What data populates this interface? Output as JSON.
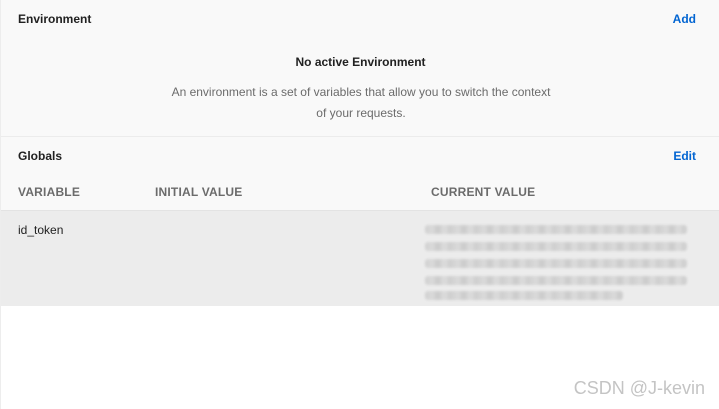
{
  "environment": {
    "title": "Environment",
    "action_label": "Add",
    "empty_title": "No active Environment",
    "empty_description": "An environment is a set of variables that allow you to switch the context of your requests."
  },
  "globals": {
    "title": "Globals",
    "action_label": "Edit",
    "columns": {
      "variable": "VARIABLE",
      "initial_value": "INITIAL VALUE",
      "current_value": "CURRENT VALUE"
    },
    "rows": [
      {
        "variable": "id_token",
        "initial_value": "",
        "current_value": ""
      }
    ]
  },
  "watermark": "CSDN @J-kevin",
  "colors": {
    "link": "#0265d2",
    "header_text": "#6b6b6b",
    "section_bg": "#f9f9f9",
    "row_bg": "#ececec"
  }
}
